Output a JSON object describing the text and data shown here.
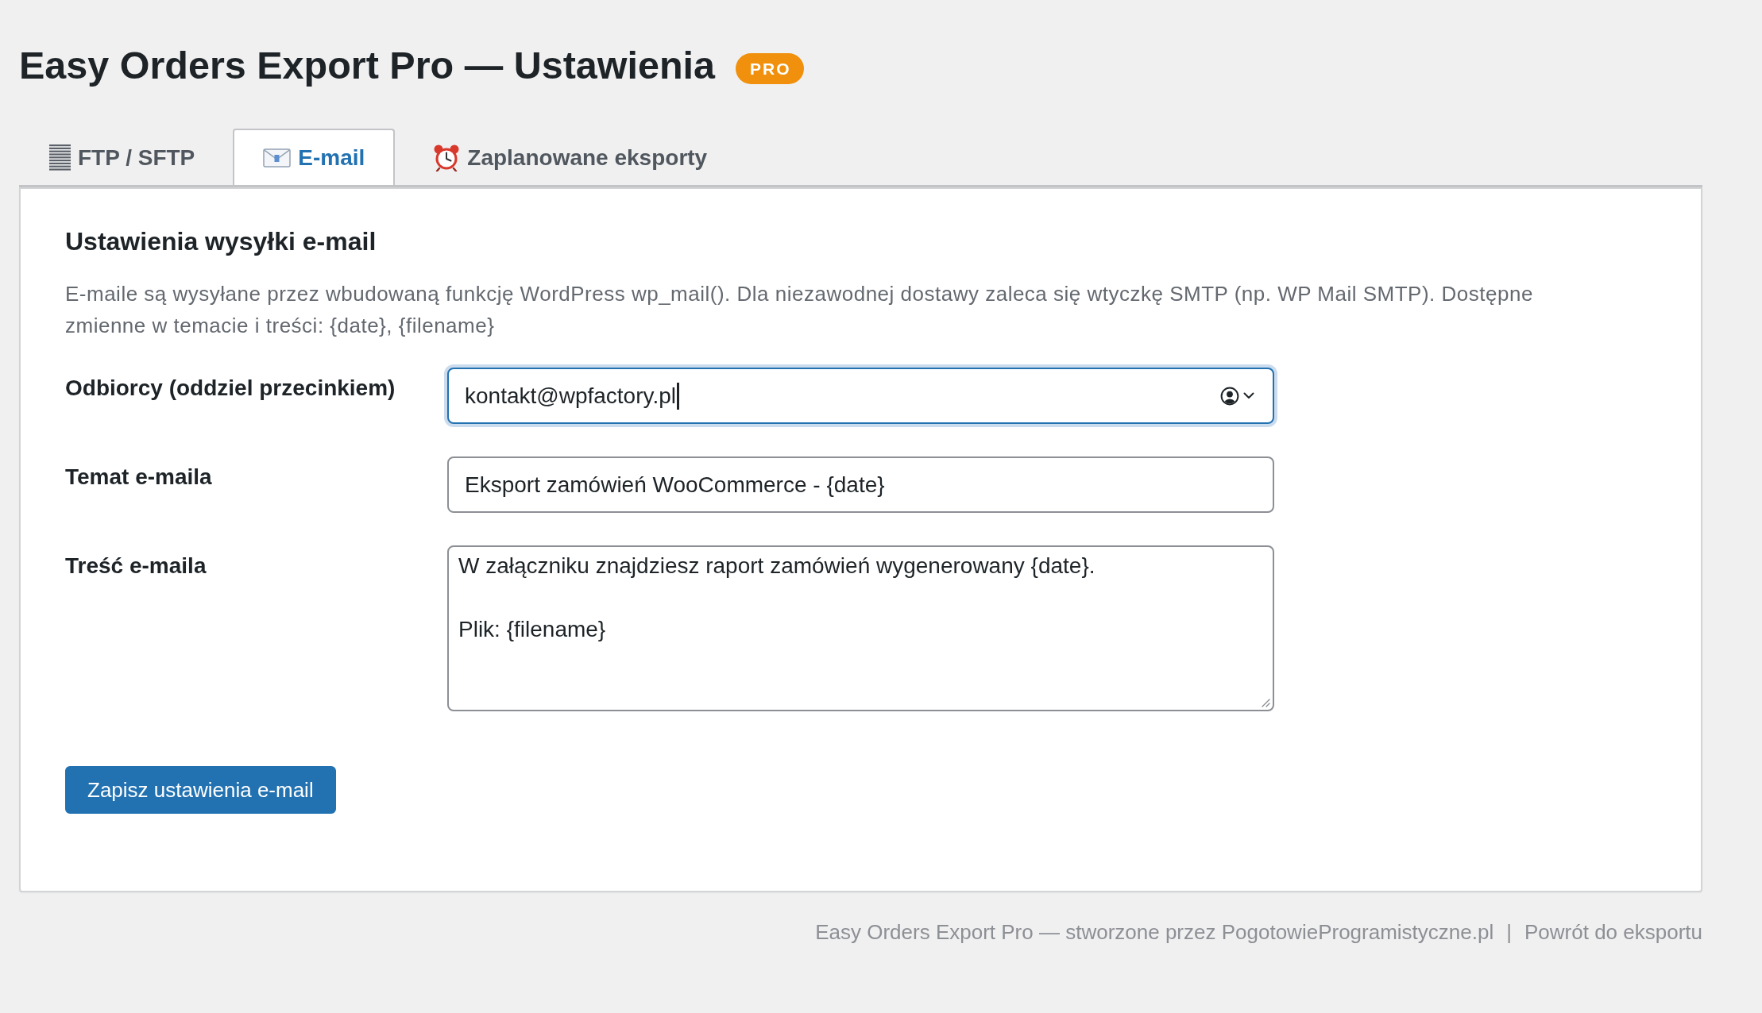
{
  "page": {
    "title": "Easy Orders Export Pro — Ustawienia",
    "badge": "PRO"
  },
  "tabs": [
    {
      "label": "FTP / SFTP",
      "kind": "server",
      "selected": false
    },
    {
      "label": "E-mail",
      "kind": "email",
      "selected": true
    },
    {
      "label": "Zaplanowane eksporty",
      "kind": "schedule",
      "selected": false
    }
  ],
  "panel": {
    "heading": "Ustawienia wysyłki e-mail",
    "description": "E-maile są wysyłane przez wbudowaną funkcję WordPress wp_mail(). Dla niezawodnej dostawy zaleca się wtyczkę SMTP (np. WP Mail SMTP). Dostępne zmienne w temacie i treści: {date}, {filename}",
    "fields": [
      {
        "label": "Odbiorcy (oddziel przecinkiem)",
        "kind": "email",
        "value": "kontakt@wpfactory.pl",
        "focused": true
      },
      {
        "label": "Temat e-maila",
        "kind": "text",
        "value": "Eksport zamówień WooCommerce - {date}",
        "focused": false
      },
      {
        "label": "Treść e-maila",
        "kind": "textarea",
        "value": "W załączniku znajdziesz raport zamówień wygenerowany {date}.\n\nPlik: {filename}",
        "focused": false
      }
    ],
    "save_button": "Zapisz ustawienia e-mail"
  },
  "footer": {
    "credit": "Easy Orders Export Pro — stworzone przez PogotowieProgramistyczne.pl",
    "separator": "|",
    "link": "Powrót do eksportu"
  }
}
